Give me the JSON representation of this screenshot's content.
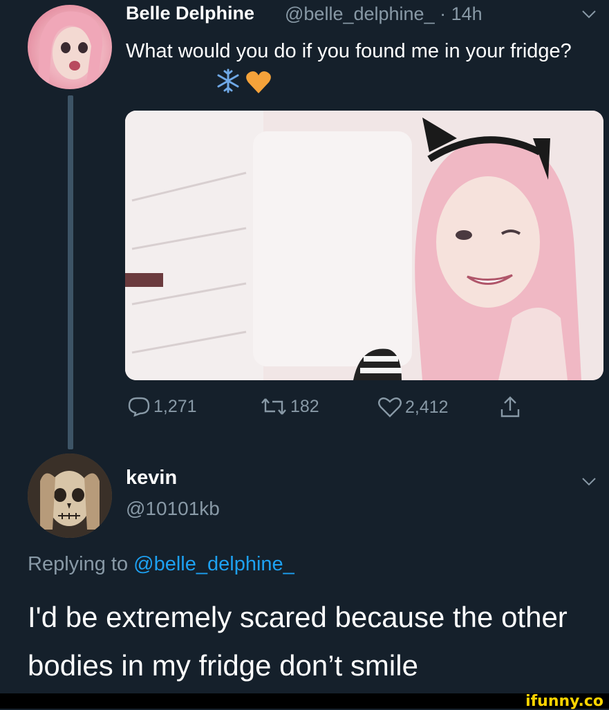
{
  "tweet": {
    "author_name": "Belle Delphine",
    "author_handle_time": "@belle_delphine_ · 14h",
    "text": "What would you do if you found me in your fridge?",
    "emojis": [
      "❄",
      "♥"
    ],
    "stats": {
      "replies": "1,271",
      "retweets": "182",
      "likes": "2,412"
    }
  },
  "reply": {
    "author_name": "kevin",
    "author_handle": "@10101kb",
    "replying_to_label": "Replying to",
    "replying_to_handle": "@belle_delphine_",
    "text": "I'd be extremely scared because the other bodies in my fridge don’t smile"
  },
  "watermark": "ifunny.co",
  "colors": {
    "background": "#15202b",
    "secondary_text": "#8899a6",
    "link": "#1da1f2",
    "watermark": "#ffd400"
  }
}
